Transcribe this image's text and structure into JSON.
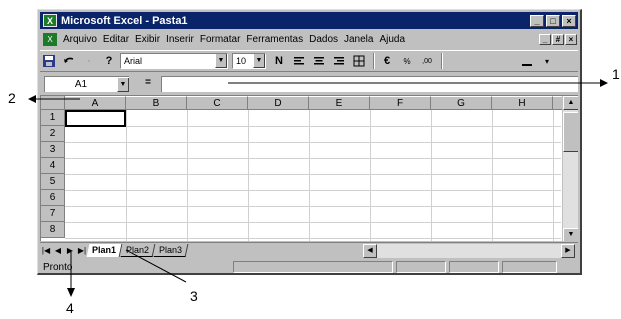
{
  "window": {
    "title": "Microsoft Excel - Pasta1",
    "app_icon": "excel-icon",
    "controls": [
      "_",
      "□",
      "×"
    ]
  },
  "menubar": {
    "items": [
      "Arquivo",
      "Editar",
      "Exibir",
      "Inserir",
      "Formatar",
      "Ferramentas",
      "Dados",
      "Janela",
      "Ajuda"
    ],
    "doc_controls": [
      "_",
      "#",
      "×"
    ]
  },
  "toolbar": {
    "font_name": "Arial",
    "font_size": "10",
    "buttons": [
      "save-icon",
      "undo-icon",
      "redo-icon",
      "help-icon",
      "bold-icon",
      "align-left-icon",
      "align-center-icon",
      "align-right-icon",
      "merge-icon",
      "currency-icon",
      "percent-icon",
      "decimal-icon",
      "border-icon"
    ]
  },
  "formulabar": {
    "cell_ref": "A1",
    "fx": "="
  },
  "grid": {
    "columns": [
      "A",
      "B",
      "C",
      "D",
      "E",
      "F",
      "G",
      "H"
    ],
    "rows": [
      "1",
      "2",
      "3",
      "4",
      "5",
      "6",
      "7",
      "8"
    ],
    "active_cell": "A1"
  },
  "sheets": {
    "tabs": [
      "Plan1",
      "Plan2",
      "Plan3"
    ],
    "active": "Plan1"
  },
  "status": {
    "text": "Pronto"
  },
  "callouts": {
    "c1": "1",
    "c2": "2",
    "c3": "3",
    "c4": "4"
  }
}
